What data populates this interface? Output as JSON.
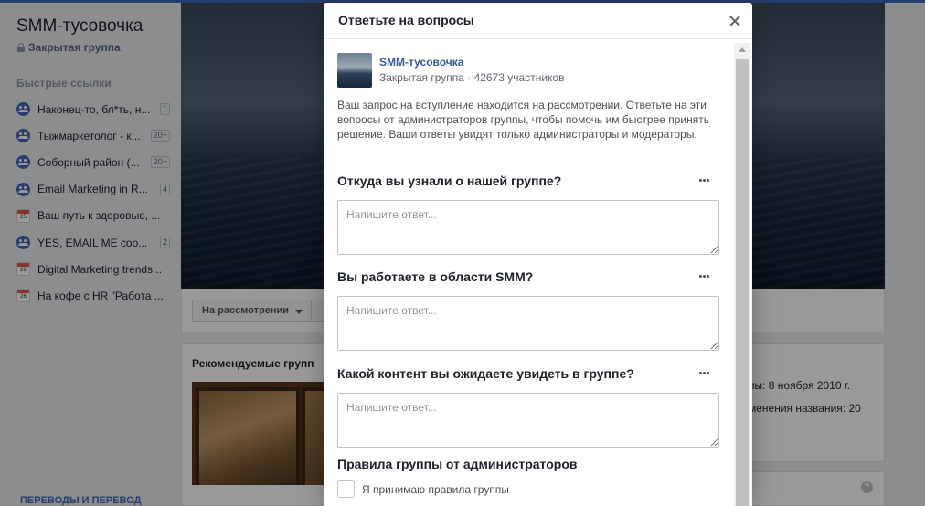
{
  "group": {
    "name": "SMM-тусовочка",
    "type": "Закрытая группа"
  },
  "quick_links": {
    "heading": "Быстрые ссылки",
    "items": [
      {
        "label": "Наконец-то, бл*ть, н...",
        "badge": "1",
        "icon": "group-icon"
      },
      {
        "label": "Тыжмаркетолог - к...",
        "badge": "20+",
        "icon": "group-icon"
      },
      {
        "label": "Соборный район (...",
        "badge": "20+",
        "icon": "group-icon"
      },
      {
        "label": "Email Marketing in R...",
        "badge": "4",
        "icon": "group-icon"
      },
      {
        "label": "Ваш путь к здоровью, ...",
        "badge": "",
        "icon": "event-icon",
        "day": "25"
      },
      {
        "label": "YES, EMAIL ME coo...",
        "badge": "2",
        "icon": "group-icon"
      },
      {
        "label": "Digital Marketing trends...",
        "badge": "",
        "icon": "event-icon",
        "day": "26"
      },
      {
        "label": "На кофе с HR \"Работа ...",
        "badge": "",
        "icon": "event-icon",
        "day": "26"
      }
    ]
  },
  "cover_bar": {
    "pending_label": "На рассмотрении"
  },
  "recommended": {
    "title": "Рекомендуемые групп",
    "link": "ПЕРЕВОДЫ И ПЕРЕВОД"
  },
  "about": {
    "line1": "пы: 8 ноября 2010 г.",
    "line2": "менения названия: 20"
  },
  "help_icon": "?",
  "modal": {
    "title": "Ответьте на вопросы",
    "group_name": "SMM-тусовочка",
    "group_meta": "Закрытая группа · 42673 участников",
    "intro": "Ваш запрос на вступление находится на рассмотрении. Ответьте на эти вопросы от администраторов группы, чтобы помочь им быстрее принять решение. Ваши ответы увидят только администраторы и модераторы.",
    "questions": [
      {
        "label": "Откуда вы узнали о нашей группе?",
        "placeholder": "Напишите ответ...",
        "value": ""
      },
      {
        "label": "Вы работаете в области SMM?",
        "placeholder": "Напишите ответ...",
        "value": ""
      },
      {
        "label": "Какой контент вы ожидаете увидеть в группе?",
        "placeholder": "Напишите ответ...",
        "value": ""
      }
    ],
    "rules_title": "Правила группы от администраторов",
    "rules_checkbox_label": "Я принимаю правила группы",
    "rules_checked": false
  },
  "colors": {
    "accent": "#4267b2",
    "link": "#385898",
    "page_bg": "#e9ebee"
  }
}
